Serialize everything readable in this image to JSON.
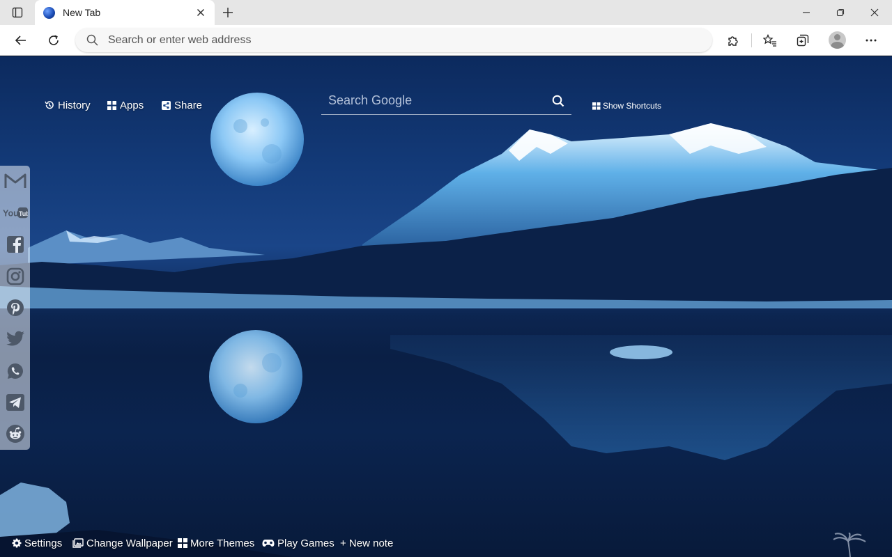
{
  "browser": {
    "tab": {
      "title": "New Tab"
    },
    "address_bar": {
      "placeholder": "Search or enter web address"
    }
  },
  "newtab": {
    "top_links": {
      "history": "History",
      "apps": "Apps",
      "share": "Share"
    },
    "search": {
      "placeholder": "Search Google"
    },
    "shortcuts_label": "Show Shortcuts",
    "social_icons": [
      "gmail-icon",
      "youtube-icon",
      "facebook-icon",
      "instagram-icon",
      "pinterest-icon",
      "twitter-icon",
      "whatsapp-icon",
      "telegram-icon",
      "reddit-icon"
    ],
    "bottom_links": {
      "settings": "Settings",
      "change_wallpaper": "Change Wallpaper",
      "more_themes": "More Themes",
      "play_games": "Play Games",
      "new_note": "+ New note"
    }
  },
  "colors": {
    "chrome_bg": "#e6e6e6",
    "toolbar_bg": "#ffffff",
    "wallpaper_sky": "#133a78",
    "wallpaper_water": "#0a1f45",
    "moon": "#9fd3ff"
  }
}
